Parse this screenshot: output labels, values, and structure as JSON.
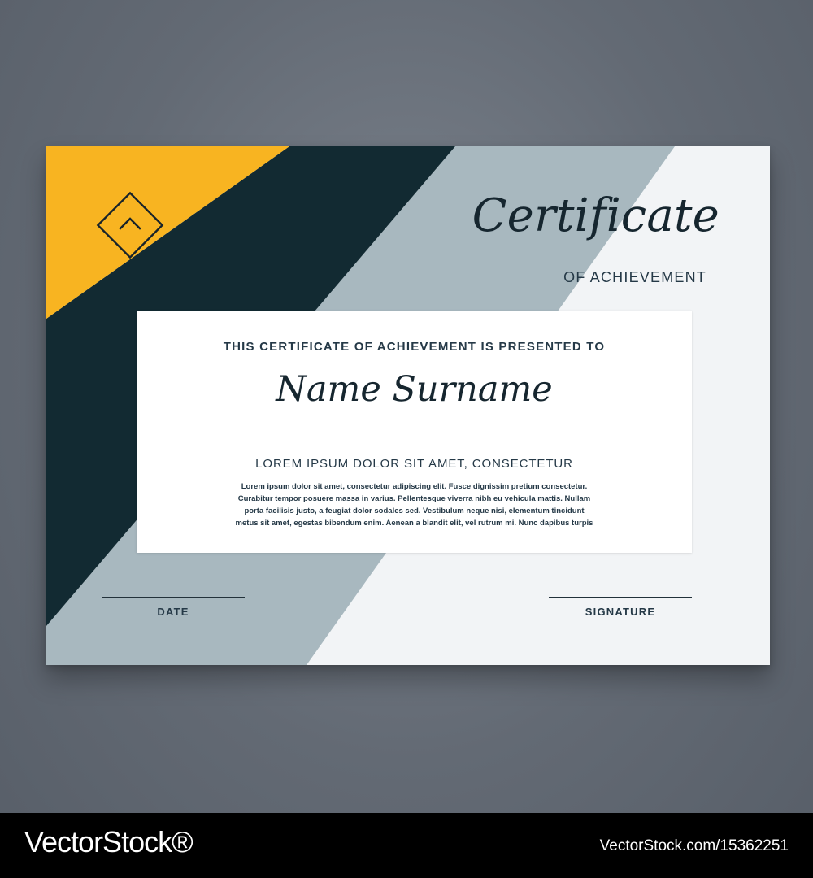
{
  "certificate": {
    "title": "Certificate",
    "subtitle": "OF ACHIEVEMENT",
    "presented_to": "THIS CERTIFICATE OF ACHIEVEMENT IS PRESENTED TO",
    "recipient_name": "Name Surname",
    "headline": "LOREM IPSUM DOLOR SIT AMET, CONSECTETUR",
    "body_lines": [
      "Lorem ipsum dolor sit amet, consectetur adipiscing elit. Fusce dignissim pretium consectetur.",
      "Curabitur tempor posuere massa in varius. Pellentesque viverra nibh eu vehicula mattis. Nullam",
      "porta facilisis justo, a feugiat dolor sodales sed. Vestibulum neque nisi, elementum tincidunt",
      "metus sit amet, egestas bibendum enim. Aenean a blandit elit, vel rutrum mi. Nunc dapibus turpis"
    ],
    "date_label": "DATE",
    "signature_label": "SIGNATURE"
  },
  "colors": {
    "background": "#6b727c",
    "yellow": "#f8b421",
    "dark": "#122a32",
    "gray_blue": "#a8b8bf",
    "light_gray": "#e9ebed",
    "panel": "#ffffff",
    "text": "#253947"
  },
  "icons": {
    "logo": "diamond-chevron-icon"
  },
  "watermark": {
    "brand": "VectorStock®",
    "id": "VectorStock.com/15362251"
  }
}
